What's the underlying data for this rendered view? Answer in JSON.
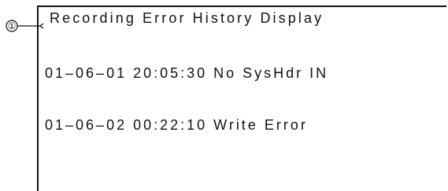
{
  "callout": {
    "label": "①"
  },
  "screen": {
    "title": "Recording Error History Display",
    "entries": [
      "01–06–01 20:05:30 No SysHdr IN",
      "01–06–02 00:22:10 Write Error"
    ]
  }
}
